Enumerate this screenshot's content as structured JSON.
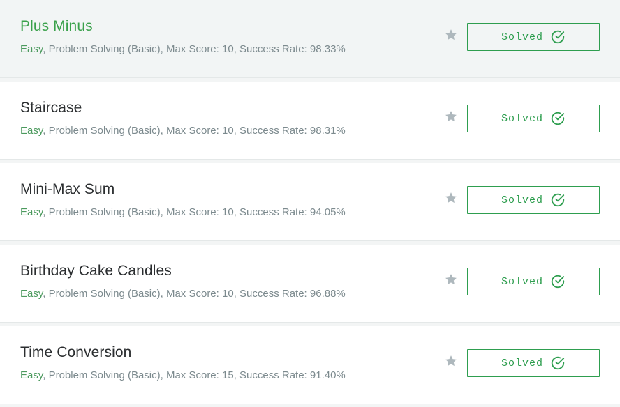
{
  "colors": {
    "accent_green": "#2e9e4f",
    "title_highlight": "#3aa14b",
    "difficulty_green": "#4c9a5e",
    "meta_gray": "#7c8a8e",
    "star_gray": "#aeb8bd"
  },
  "challenges": [
    {
      "title": "Plus Minus",
      "difficulty": "Easy",
      "details": ", Problem Solving (Basic), Max Score: 10, Success Rate: 98.33%",
      "status": "Solved",
      "bookmark_icon": "star-icon",
      "status_icon": "check-circle-icon"
    },
    {
      "title": "Staircase",
      "difficulty": "Easy",
      "details": ", Problem Solving (Basic), Max Score: 10, Success Rate: 98.31%",
      "status": "Solved",
      "bookmark_icon": "star-icon",
      "status_icon": "check-circle-icon"
    },
    {
      "title": "Mini-Max Sum",
      "difficulty": "Easy",
      "details": ", Problem Solving (Basic), Max Score: 10, Success Rate: 94.05%",
      "status": "Solved",
      "bookmark_icon": "star-icon",
      "status_icon": "check-circle-icon"
    },
    {
      "title": "Birthday Cake Candles",
      "difficulty": "Easy",
      "details": ", Problem Solving (Basic), Max Score: 10, Success Rate: 96.88%",
      "status": "Solved",
      "bookmark_icon": "star-icon",
      "status_icon": "check-circle-icon"
    },
    {
      "title": "Time Conversion",
      "difficulty": "Easy",
      "details": ", Problem Solving (Basic), Max Score: 15, Success Rate: 91.40%",
      "status": "Solved",
      "bookmark_icon": "star-icon",
      "status_icon": "check-circle-icon"
    }
  ]
}
